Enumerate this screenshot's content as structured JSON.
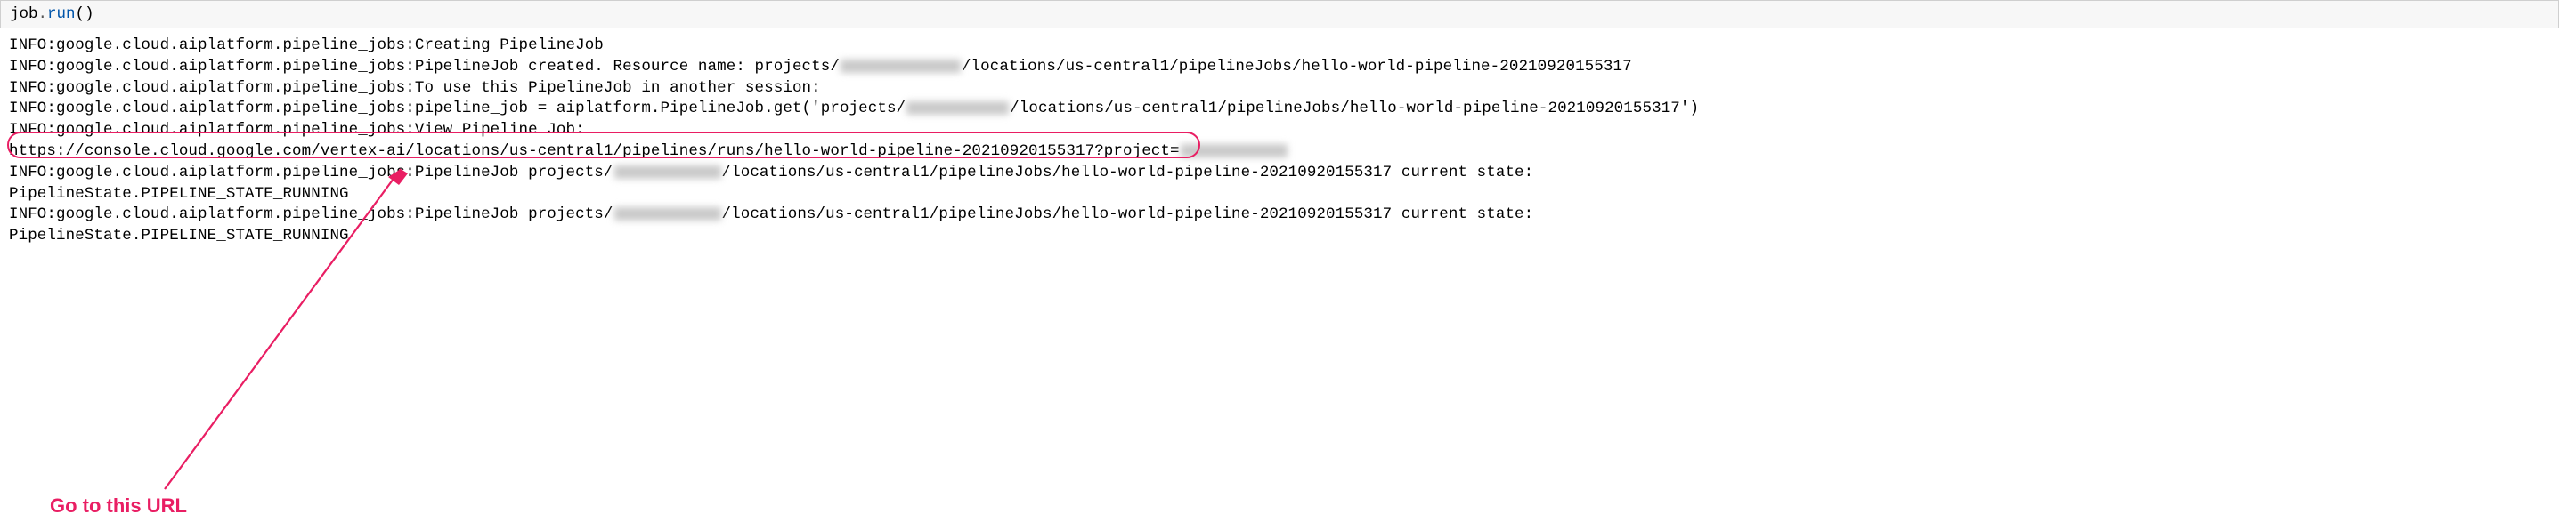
{
  "code": {
    "object": "job",
    "method": "run",
    "parens": "()"
  },
  "output": {
    "line1": "INFO:google.cloud.aiplatform.pipeline_jobs:Creating PipelineJob",
    "line2a": "INFO:google.cloud.aiplatform.pipeline_jobs:PipelineJob created. Resource name: projects/",
    "line2b": "/locations/us-central1/pipelineJobs/hello-world-pipeline-20210920155317",
    "line3": "INFO:google.cloud.aiplatform.pipeline_jobs:To use this PipelineJob in another session:",
    "line4a": "INFO:google.cloud.aiplatform.pipeline_jobs:pipeline_job = aiplatform.PipelineJob.get('projects/",
    "line4b": "/locations/us-central1/pipelineJobs/hello-world-pipeline-20210920155317')",
    "line5": "INFO:google.cloud.aiplatform.pipeline_jobs:View Pipeline Job:",
    "line6a": "https://console.cloud.google.com/vertex-ai/locations/us-central1/pipelines/runs/hello-world-pipeline-20210920155317?project=",
    "line7a": "INFO:google.cloud.aiplatform.pipeline_jobs:PipelineJob projects/",
    "line7b": "/locations/us-central1/pipelineJobs/hello-world-pipeline-20210920155317 current state:",
    "line8": "PipelineState.PIPELINE_STATE_RUNNING",
    "line9a": "INFO:google.cloud.aiplatform.pipeline_jobs:PipelineJob projects/",
    "line9b": "/locations/us-central1/pipelineJobs/hello-world-pipeline-20210920155317 current state:",
    "line10": "PipelineState.PIPELINE_STATE_RUNNING"
  },
  "annotation": {
    "text": "Go to this URL",
    "color": "#e91e63"
  }
}
